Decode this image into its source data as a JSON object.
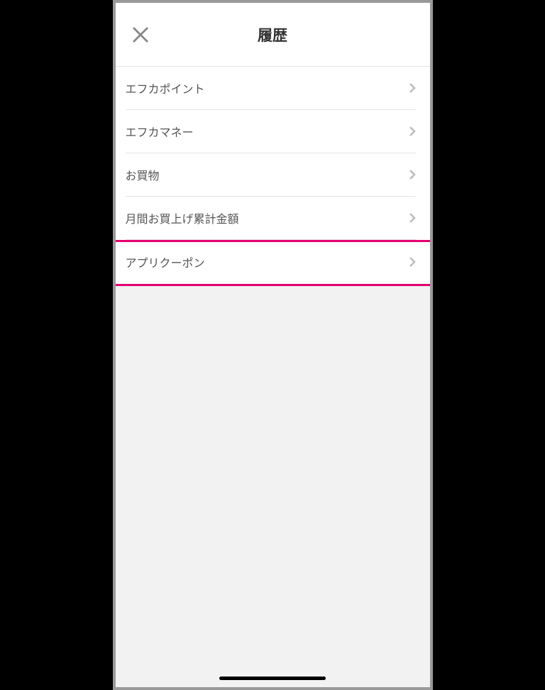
{
  "header": {
    "title": "履歴"
  },
  "list": {
    "items": [
      {
        "label": "エフカポイント"
      },
      {
        "label": "エフカマネー"
      },
      {
        "label": "お買物"
      },
      {
        "label": "月間お買上げ累計金額"
      },
      {
        "label": "アプリクーポン"
      }
    ]
  }
}
